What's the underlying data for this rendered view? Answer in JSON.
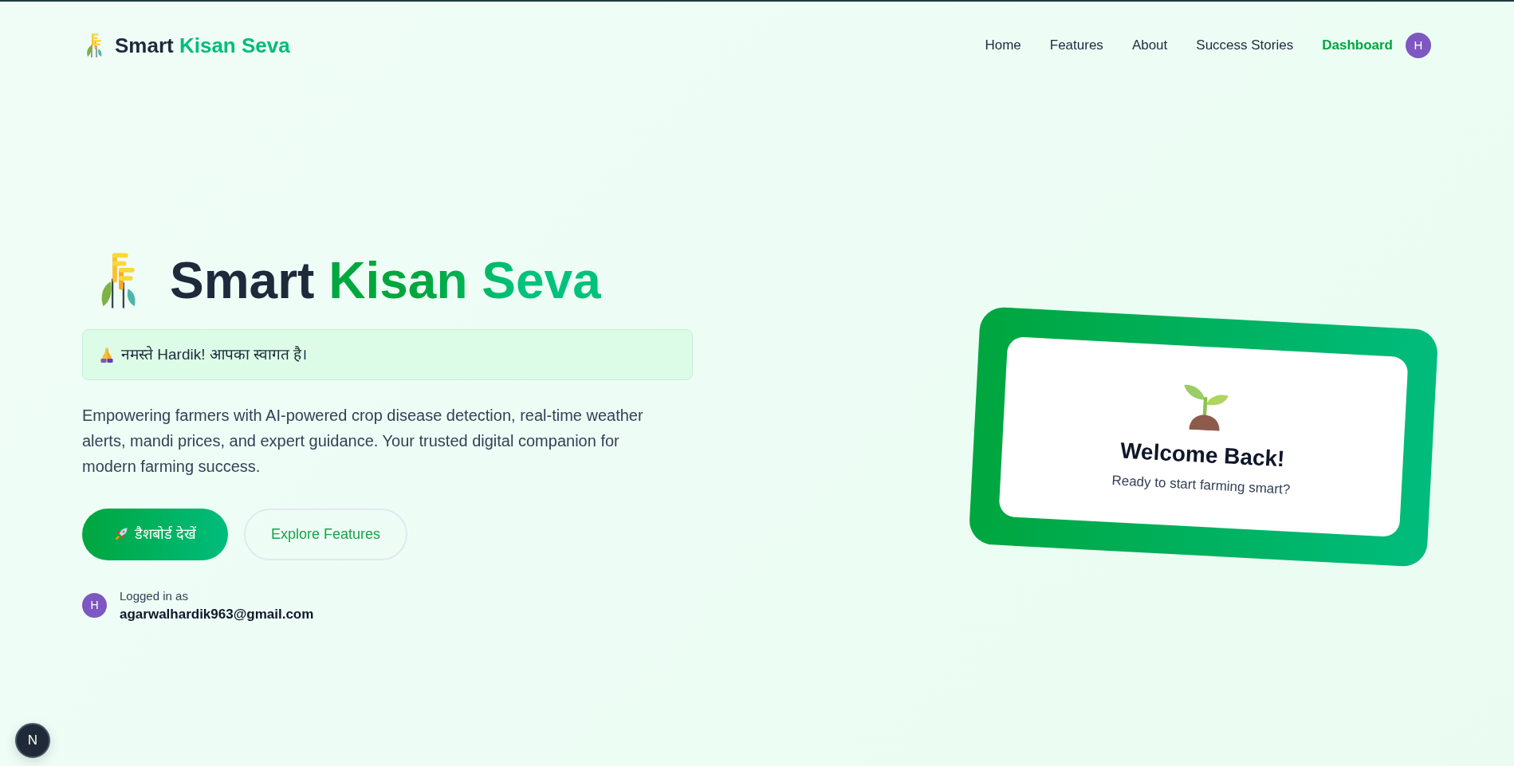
{
  "header": {
    "brand": {
      "title": "Smart",
      "title_accent": "Kisan Seva"
    },
    "nav": [
      {
        "label": "Home",
        "selected": false
      },
      {
        "label": "Features",
        "selected": false
      },
      {
        "label": "About",
        "selected": false
      },
      {
        "label": "Success Stories",
        "selected": false
      },
      {
        "label": "Dashboard",
        "selected": true
      }
    ],
    "avatar": {
      "initial": "H"
    }
  },
  "hero": {
    "title": "Smart",
    "title_accent": "Kisan Seva",
    "greeting": "नमस्ते Hardik! आपका स्वागत है।",
    "description": "Empowering farmers with AI-powered crop disease detection, real-time weather alerts, mandi prices, and expert guidance. Your trusted digital companion for modern farming success.",
    "buttons": [
      {
        "label": "डैशबोर्ड देखें",
        "kind": "primary"
      },
      {
        "label": "Explore Features",
        "kind": "outline"
      }
    ],
    "user": {
      "initial": "H",
      "label": "Logged in as",
      "email": "agarwalhardik963@gmail.com"
    }
  },
  "welcome_card": {
    "title": "Welcome Back!",
    "subtitle": "Ready to start farming smart?"
  },
  "dev_indicator": {
    "label": "N"
  }
}
